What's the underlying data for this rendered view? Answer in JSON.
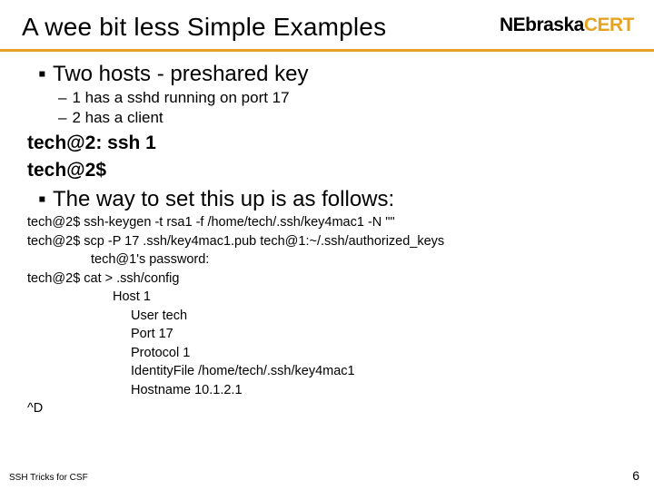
{
  "title": "A wee bit less Simple Examples",
  "logo": {
    "part1": "NEbraska",
    "part2": "CERT"
  },
  "bullet1": {
    "marker": "▪",
    "text": "Two hosts - preshared key"
  },
  "sub1": {
    "dash": "–",
    "text": "1 has a sshd running on port 17"
  },
  "sub2": {
    "dash": "–",
    "text": "2 has a client"
  },
  "cmd1": "tech@2: ssh 1",
  "cmd2": "tech@2$",
  "bullet2": {
    "marker": "▪",
    "text": "The way to set this up is as follows:"
  },
  "code": {
    "l1": "tech@2$ ssh-keygen -t rsa1 -f /home/tech/.ssh/key4mac1 -N \"\"",
    "l2": "tech@2$ scp -P 17 .ssh/key4mac1.pub tech@1:~/.ssh/authorized_keys",
    "l3": "tech@1's password:",
    "l4": "tech@2$ cat > .ssh/config",
    "l5": "Host 1",
    "l6": "User tech",
    "l7": "Port 17",
    "l8": "Protocol 1",
    "l9": "IdentityFile /home/tech/.ssh/key4mac1",
    "l10": "Hostname 10.1.2.1",
    "l11": "^D"
  },
  "footer": {
    "left": "SSH Tricks for CSF",
    "right": "6"
  }
}
